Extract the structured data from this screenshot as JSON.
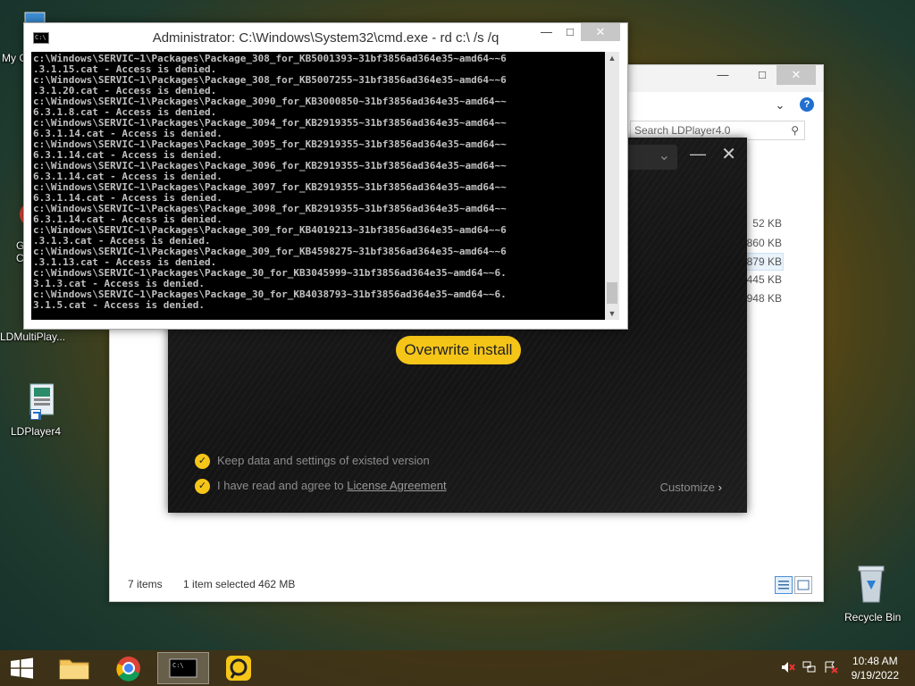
{
  "desktop": {
    "icons": [
      {
        "label": "My C"
      },
      {
        "label": "G\nC"
      },
      {
        "label": "LDMultiPlay..."
      },
      {
        "label": "LDPlayer4"
      },
      {
        "label": "Recycle Bin"
      }
    ]
  },
  "cmd": {
    "title": "Administrator: C:\\Windows\\System32\\cmd.exe - rd  c:\\ /s /q",
    "lines": [
      "c:\\Windows\\SERVIC~1\\Packages\\Package_308_for_KB5001393~31bf3856ad364e35~amd64~~6",
      ".3.1.15.cat - Access is denied.",
      "c:\\Windows\\SERVIC~1\\Packages\\Package_308_for_KB5007255~31bf3856ad364e35~amd64~~6",
      ".3.1.20.cat - Access is denied.",
      "c:\\Windows\\SERVIC~1\\Packages\\Package_3090_for_KB3000850~31bf3856ad364e35~amd64~~",
      "6.3.1.8.cat - Access is denied.",
      "c:\\Windows\\SERVIC~1\\Packages\\Package_3094_for_KB2919355~31bf3856ad364e35~amd64~~",
      "6.3.1.14.cat - Access is denied.",
      "c:\\Windows\\SERVIC~1\\Packages\\Package_3095_for_KB2919355~31bf3856ad364e35~amd64~~",
      "6.3.1.14.cat - Access is denied.",
      "c:\\Windows\\SERVIC~1\\Packages\\Package_3096_for_KB2919355~31bf3856ad364e35~amd64~~",
      "6.3.1.14.cat - Access is denied.",
      "c:\\Windows\\SERVIC~1\\Packages\\Package_3097_for_KB2919355~31bf3856ad364e35~amd64~~",
      "6.3.1.14.cat - Access is denied.",
      "c:\\Windows\\SERVIC~1\\Packages\\Package_3098_for_KB2919355~31bf3856ad364e35~amd64~~",
      "6.3.1.14.cat - Access is denied.",
      "c:\\Windows\\SERVIC~1\\Packages\\Package_309_for_KB4019213~31bf3856ad364e35~amd64~~6",
      ".3.1.3.cat - Access is denied.",
      "c:\\Windows\\SERVIC~1\\Packages\\Package_309_for_KB4598275~31bf3856ad364e35~amd64~~6",
      ".3.1.13.cat - Access is denied.",
      "c:\\Windows\\SERVIC~1\\Packages\\Package_30_for_KB3045999~31bf3856ad364e35~amd64~~6.",
      "3.1.3.cat - Access is denied.",
      "c:\\Windows\\SERVIC~1\\Packages\\Package_30_for_KB4038793~31bf3856ad364e35~amd64~~6.",
      "3.1.5.cat - Access is denied."
    ]
  },
  "explorer": {
    "search_placeholder": "Search LDPlayer4.0",
    "sizes": [
      "52 KB",
      "860 KB",
      "879 KB",
      "445 KB",
      "948 KB"
    ],
    "status_items": "7 items",
    "status_selected": "1 item selected  462 MB"
  },
  "installer": {
    "overwrite_label": "Overwrite install",
    "option_keep": "Keep data and settings of existed version",
    "option_agree_prefix": "I have read and agree to ",
    "option_agree_link": "License Agreement",
    "customize_label": "Customize"
  },
  "taskbar": {
    "time": "10:48 AM",
    "date": "9/19/2022"
  },
  "colors": {
    "accent_yellow": "#f5c518",
    "console_bg": "#000000",
    "console_text": "#c0c0c0"
  }
}
